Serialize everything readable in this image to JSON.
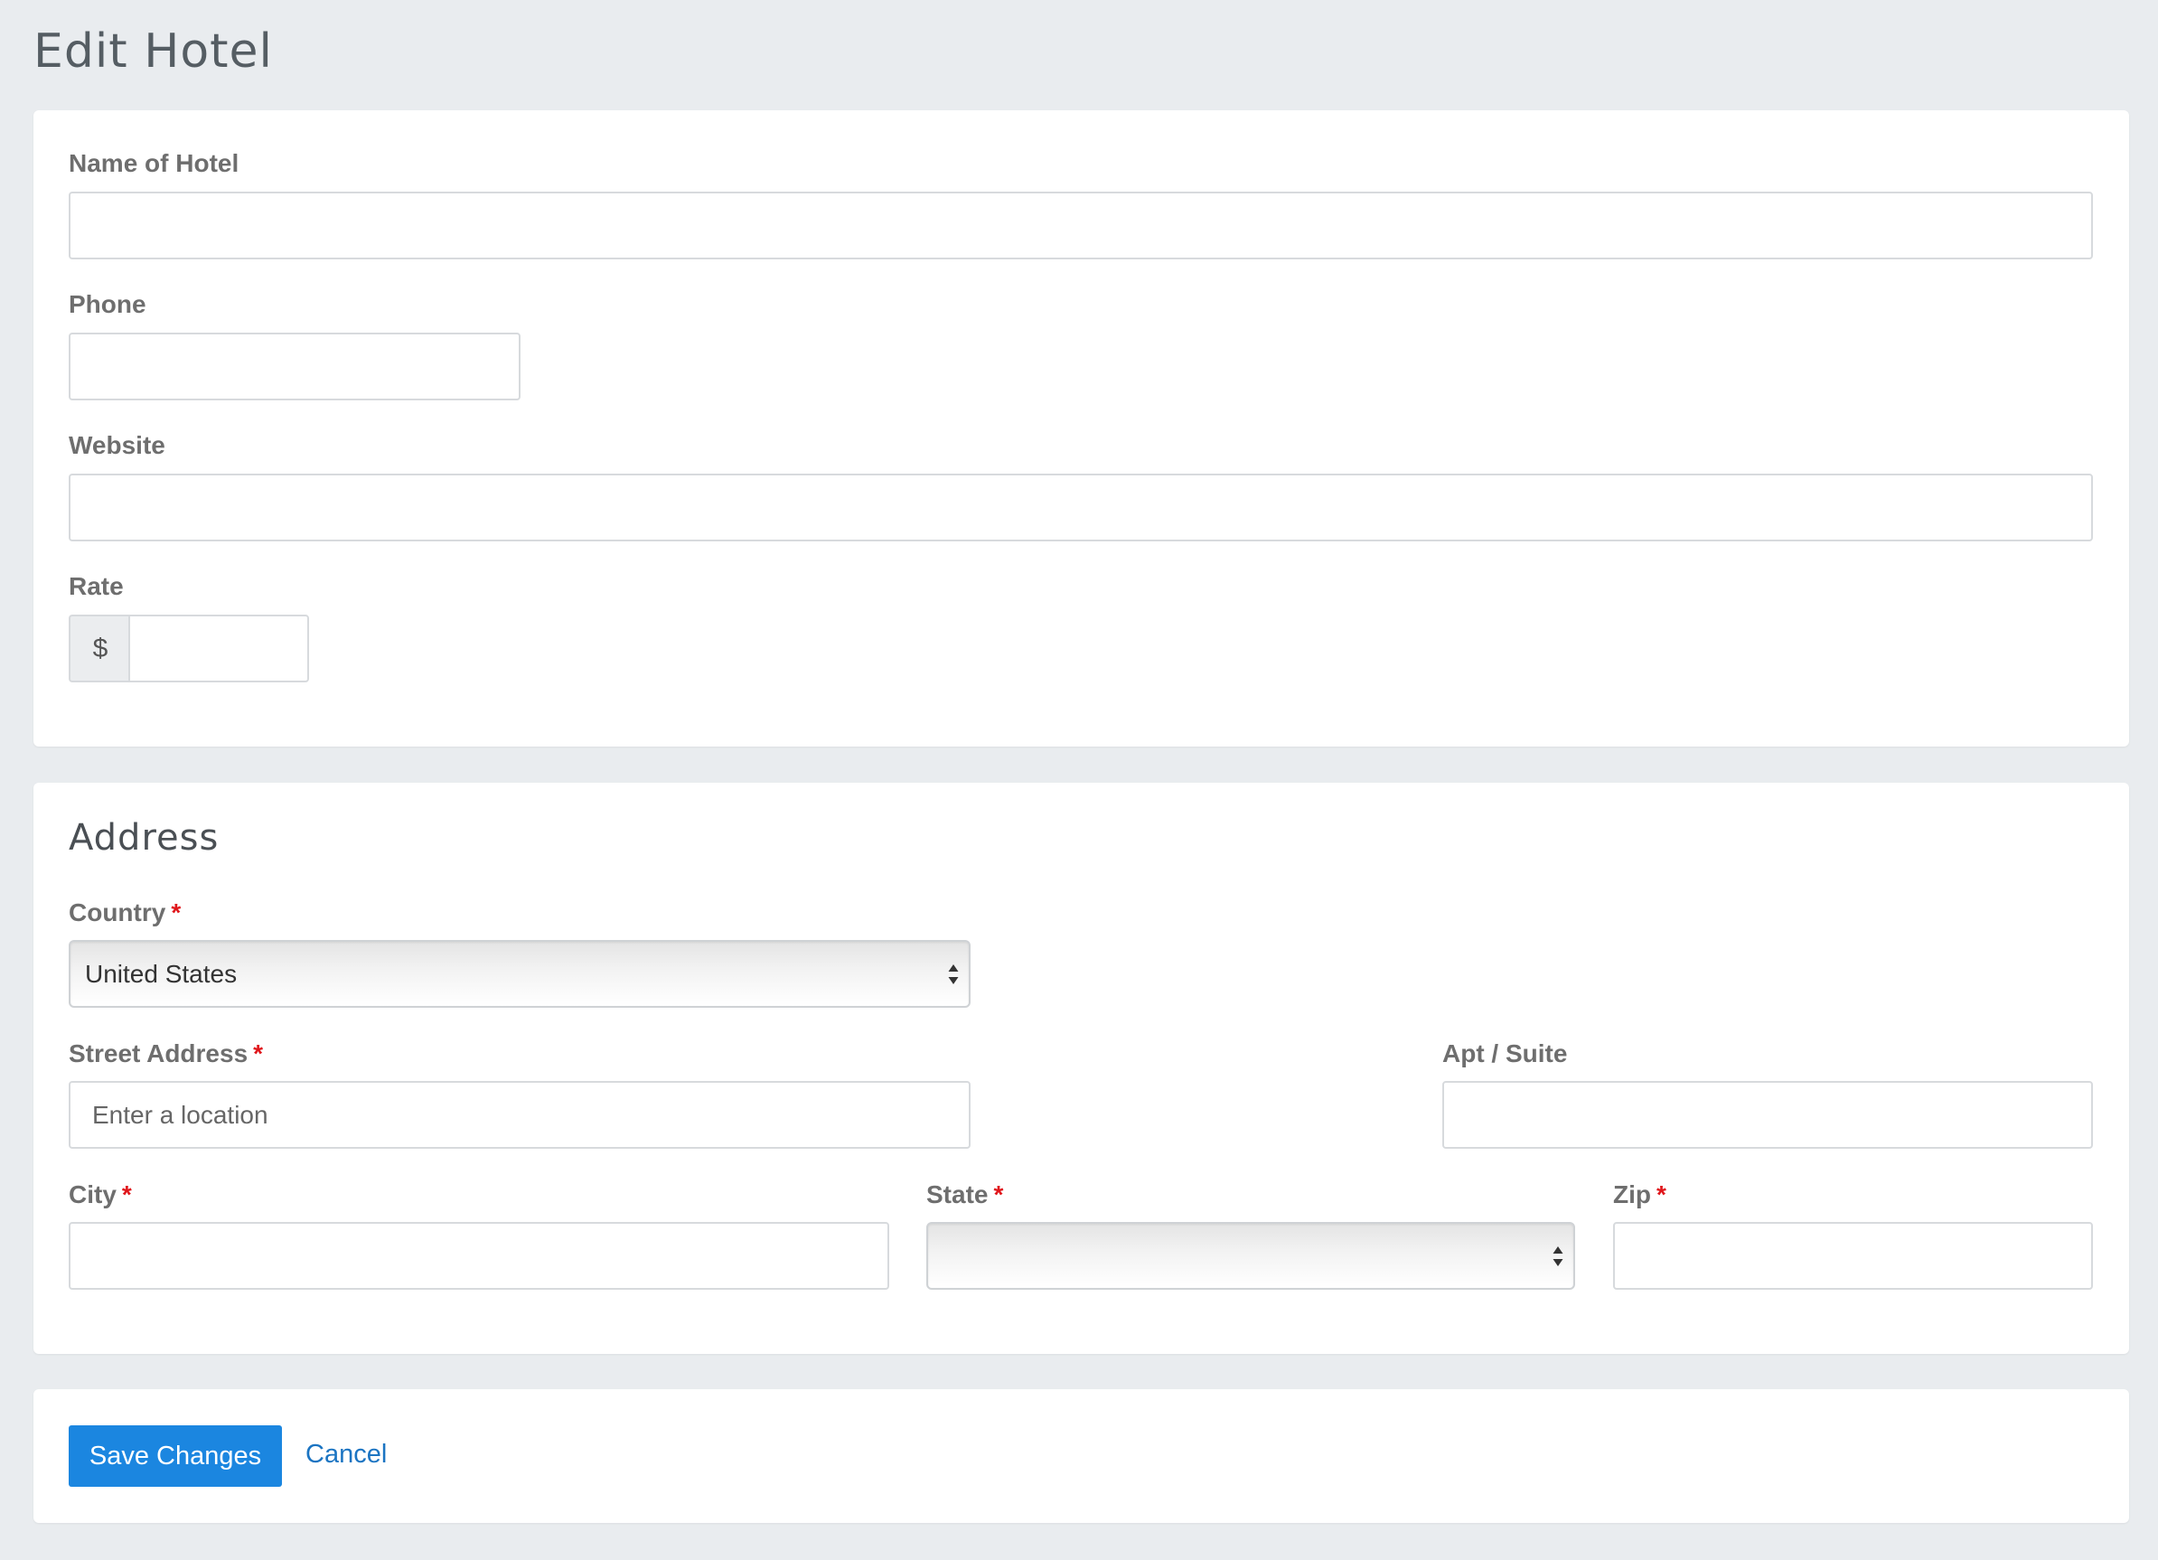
{
  "page": {
    "title": "Edit Hotel"
  },
  "hotel_form": {
    "name_label": "Name of Hotel",
    "name_value": "",
    "phone_label": "Phone",
    "phone_value": "",
    "website_label": "Website",
    "website_value": "",
    "rate_label": "Rate",
    "rate_currency": "$",
    "rate_value": ""
  },
  "address_form": {
    "section_title": "Address",
    "required_marker": "*",
    "country_label": "Country",
    "country_selected": "United States",
    "street_label": "Street Address",
    "street_placeholder": "Enter a location",
    "apt_label": "Apt / Suite",
    "city_label": "City",
    "state_label": "State",
    "state_selected": "",
    "zip_label": "Zip"
  },
  "actions": {
    "save_label": "Save Changes",
    "cancel_label": "Cancel"
  },
  "colors": {
    "background": "#e9ecef",
    "primary": "#1b86e0",
    "link": "#1b74c2",
    "required": "#e0161b"
  },
  "icons": {
    "select_arrows": "select-arrows-icon"
  }
}
